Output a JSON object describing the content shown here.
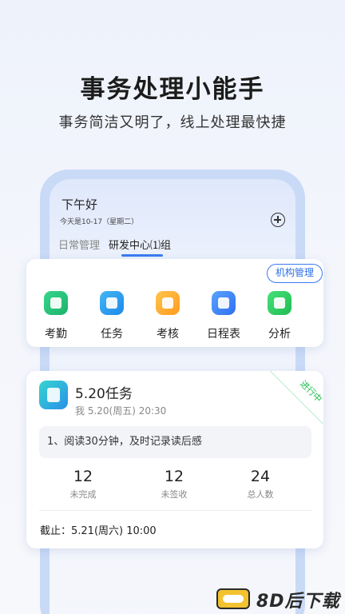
{
  "promo": {
    "headline": "事务处理小能手",
    "subline": "事务简洁又明了，线上处理最快捷"
  },
  "header": {
    "greeting": "下午好",
    "date": "今天是10-17（星期二）"
  },
  "tabs": [
    {
      "label": "日常管理",
      "active": false
    },
    {
      "label": "研发中心⑴组",
      "active": true
    }
  ],
  "org_button": "机构管理",
  "features": [
    {
      "label": "考勤",
      "icon": "attendance-icon",
      "color": "#1bb36a"
    },
    {
      "label": "任务",
      "icon": "task-icon",
      "color": "#1d88e8"
    },
    {
      "label": "考核",
      "icon": "assessment-icon",
      "color": "#ff9b1e"
    },
    {
      "label": "日程表",
      "icon": "calendar-icon",
      "color": "#2f6ff0"
    },
    {
      "label": "分析",
      "icon": "analysis-icon",
      "color": "#1fbd52"
    }
  ],
  "task": {
    "title": "5.20任务",
    "meta": "我   5.20(周五)  20:30",
    "status": "进行中",
    "description": "1、阅读30分钟，及时记录读后感",
    "stats": [
      {
        "value": "12",
        "label": "未完成"
      },
      {
        "value": "12",
        "label": "未签收"
      },
      {
        "value": "24",
        "label": "总人数"
      }
    ],
    "deadline": "截止：5.21(周六)  10:00"
  },
  "watermark": "8D后下载"
}
